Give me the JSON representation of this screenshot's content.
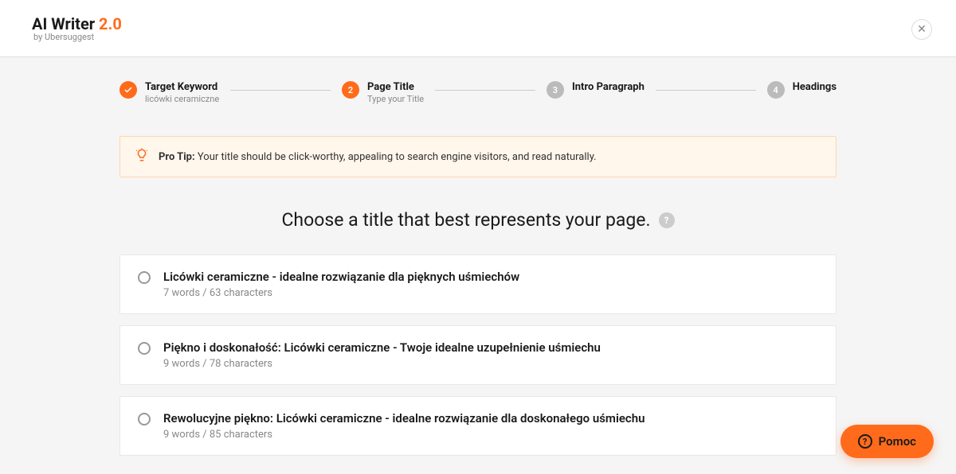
{
  "header": {
    "logo_main": "AI Writer ",
    "logo_accent": "2.0",
    "logo_sub": "by Ubersuggest"
  },
  "stepper": {
    "steps": [
      {
        "num": "✓",
        "title": "Target Keyword",
        "sub": "licówki ceramiczne"
      },
      {
        "num": "2",
        "title": "Page Title",
        "sub": "Type your Title"
      },
      {
        "num": "3",
        "title": "Intro Paragraph",
        "sub": ""
      },
      {
        "num": "4",
        "title": "Headings",
        "sub": ""
      }
    ]
  },
  "tip": {
    "label": "Pro Tip:",
    "text": " Your title should be click-worthy, appealing to search engine visitors, and read naturally."
  },
  "heading": "Choose a title that best represents your page.",
  "options": [
    {
      "title": "Licówki ceramiczne - idealne rozwiązanie dla pięknych uśmiechów",
      "meta": "7 words / 63 characters"
    },
    {
      "title": "Piękno i doskonałość: Licówki ceramiczne - Twoje idealne uzupełnienie uśmiechu",
      "meta": "9 words / 78 characters"
    },
    {
      "title": "Rewolucyjne piękno: Licówki ceramiczne - idealne rozwiązanie dla doskonałego uśmiechu",
      "meta": "9 words / 85 characters"
    }
  ],
  "help_button": "Pomoc"
}
